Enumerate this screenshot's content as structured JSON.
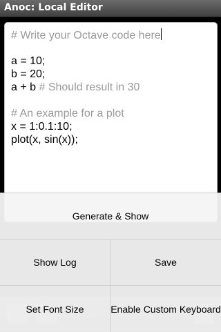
{
  "app": {
    "title": "Anoc: Local Editor"
  },
  "editor": {
    "lines": [
      {
        "code": "",
        "comment": "# Write your Octave code here"
      },
      {
        "code": "",
        "comment": ""
      },
      {
        "code": "a = 10;",
        "comment": ""
      },
      {
        "code": "b = 20;",
        "comment": ""
      },
      {
        "code": "a + b ",
        "comment": "# Should result in 30"
      },
      {
        "code": "",
        "comment": ""
      },
      {
        "code": "",
        "comment": "# An example for a plot"
      },
      {
        "code": "x = 1:0.1:10;",
        "comment": ""
      },
      {
        "code": "plot(x, sin(x));",
        "comment": ""
      }
    ]
  },
  "menu": {
    "generate_show": "Generate & Show",
    "show_log": "Show Log",
    "save": "Save",
    "set_font_size": "Set Font Size",
    "enable_custom_keyboard": "Enable Custom Keyboard"
  },
  "bottom_bar": {
    "icons": [
      "add-icon",
      "keyboard-icon",
      "menu-icon"
    ]
  }
}
